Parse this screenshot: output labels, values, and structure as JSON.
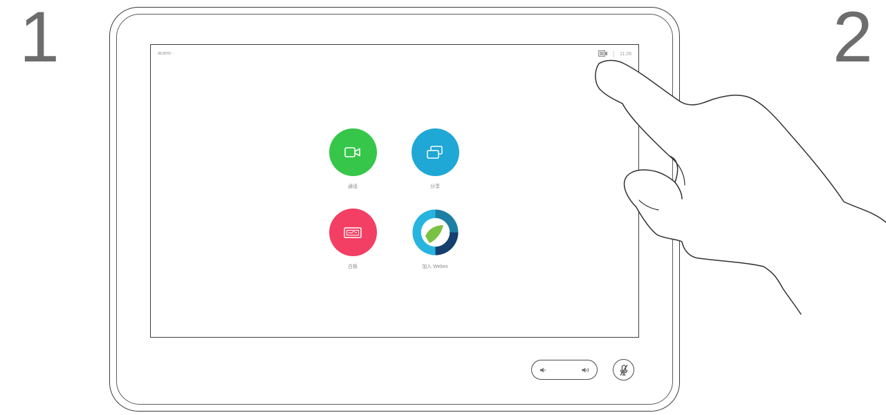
{
  "steps": {
    "first": "1",
    "second": "2"
  },
  "status_bar": {
    "left_text": "acano ·",
    "time": "11:28",
    "camera_icon": "camera-self-view-icon"
  },
  "tiles": [
    {
      "label": "通话",
      "icon": "video-camera-icon",
      "color": "#36c64a"
    },
    {
      "label": "分享",
      "icon": "share-screens-icon",
      "color": "#1fa7d6"
    },
    {
      "label": "白板",
      "icon": "whiteboard-icon",
      "color": "#f23f63"
    },
    {
      "label": "加入 Webex",
      "icon": "webex-logo-icon",
      "color": "#1fa7d6"
    }
  ],
  "controls": {
    "volume_down_icon": "volume-down-icon",
    "volume_up_icon": "volume-up-icon",
    "mute_icon": "microphone-mute-icon"
  },
  "colors": {
    "outline": "#3a3a3a",
    "step_number": "#6d6d6d"
  }
}
